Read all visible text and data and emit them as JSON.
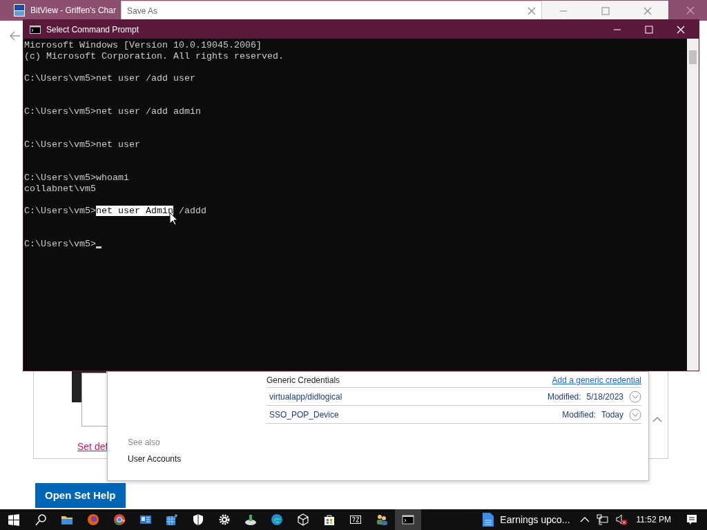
{
  "browser": {
    "title": "BitView - Griffen's Char",
    "link": "Set def",
    "button": "Open Set Help"
  },
  "save_as": {
    "title": "Save As"
  },
  "cmd": {
    "title": "Select Command Prompt",
    "lines": [
      {
        "kind": "text",
        "text": "Microsoft Windows [Version 10.0.19045.2006]"
      },
      {
        "kind": "text",
        "text": "(c) Microsoft Corporation. All rights reserved."
      },
      {
        "kind": "blank"
      },
      {
        "kind": "prompt",
        "prompt": "C:\\Users\\vm5>",
        "text": "net user /add user"
      },
      {
        "kind": "blank"
      },
      {
        "kind": "blank"
      },
      {
        "kind": "prompt",
        "prompt": "C:\\Users\\vm5>",
        "text": "net user /add admin"
      },
      {
        "kind": "blank"
      },
      {
        "kind": "blank"
      },
      {
        "kind": "prompt",
        "prompt": "C:\\Users\\vm5>",
        "text": "net user"
      },
      {
        "kind": "blank"
      },
      {
        "kind": "blank"
      },
      {
        "kind": "prompt",
        "prompt": "C:\\Users\\vm5>",
        "text": "whoami"
      },
      {
        "kind": "text",
        "text": "collabnet\\vm5"
      },
      {
        "kind": "blank"
      },
      {
        "kind": "prompt",
        "prompt": "C:\\Users\\vm5>",
        "selected_text": "net user Admin",
        "text": " /addd"
      },
      {
        "kind": "blank"
      },
      {
        "kind": "blank"
      },
      {
        "kind": "prompt",
        "prompt": "C:\\Users\\vm5>",
        "cursor": true
      }
    ]
  },
  "credentials": {
    "heading": "Generic Credentials",
    "add_link": "Add a generic credential",
    "items": [
      {
        "name": "virtualapp/didlogical",
        "label": "Modified:",
        "date": "5/18/2023"
      },
      {
        "name": "SSO_POP_Device",
        "label": "Modified:",
        "date": "Today"
      }
    ],
    "see_also": "See also",
    "user_accounts": "User Accounts"
  },
  "taskbar": {
    "apps": [
      {
        "kind": "folder",
        "selected": false
      },
      {
        "kind": "firefox",
        "selected": false
      },
      {
        "kind": "chrome",
        "selected": false
      },
      {
        "kind": "card",
        "selected": false
      },
      {
        "kind": "grid",
        "selected": false
      },
      {
        "kind": "shield",
        "selected": false
      },
      {
        "kind": "gear",
        "selected": false
      },
      {
        "kind": "drive",
        "selected": false
      },
      {
        "kind": "edge",
        "selected": false
      },
      {
        "kind": "cube",
        "selected": false
      },
      {
        "kind": "store",
        "selected": false
      },
      {
        "kind": "sevenzip",
        "selected": false
      },
      {
        "kind": "people",
        "selected": false
      },
      {
        "kind": "cmd",
        "selected": true
      }
    ],
    "news": "Earnings upco...",
    "time": "11:52 PM"
  }
}
